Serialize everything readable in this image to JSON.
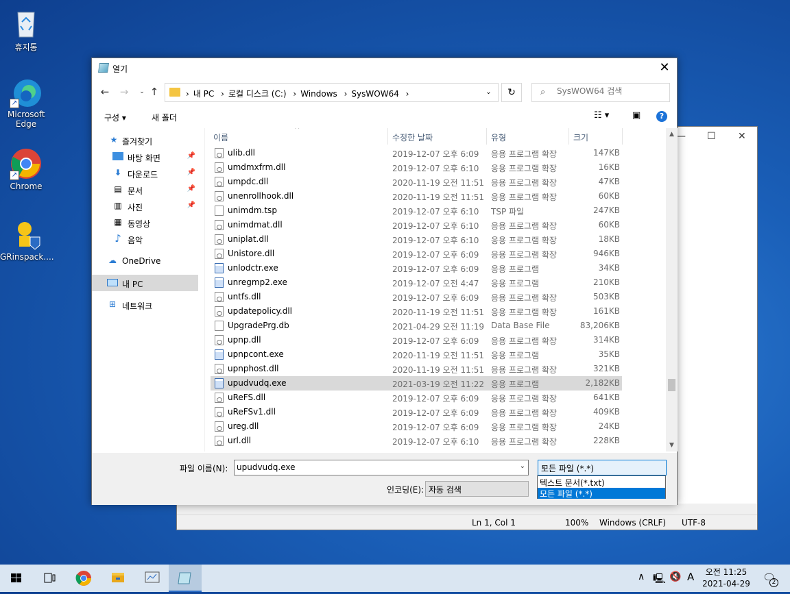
{
  "desktop": {
    "icons": [
      {
        "label": "휴지통"
      },
      {
        "label": "Microsoft Edge"
      },
      {
        "label": "Chrome"
      },
      {
        "label": "GRinspack...."
      }
    ]
  },
  "notepad": {
    "status": {
      "position": "Ln 1, Col 1",
      "zoom": "100%",
      "line_endings": "Windows (CRLF)",
      "encoding": "UTF-8"
    }
  },
  "dialog": {
    "title": "열기",
    "breadcrumbs": [
      "내 PC",
      "로컬 디스크 (C:)",
      "Windows",
      "SysWOW64"
    ],
    "search_placeholder": "SysWOW64 검색",
    "toolbar": {
      "organize": "구성 ▾",
      "new_folder": "새 폴더"
    },
    "nav": [
      {
        "label": "즐겨찾기",
        "icon": "star-icon"
      },
      {
        "label": "바탕 화면",
        "icon": "desktop-icon",
        "pinned": true
      },
      {
        "label": "다운로드",
        "icon": "download-icon",
        "pinned": true
      },
      {
        "label": "문서",
        "icon": "document-icon",
        "pinned": true
      },
      {
        "label": "사진",
        "icon": "pictures-icon",
        "pinned": true
      },
      {
        "label": "동영상",
        "icon": "video-icon"
      },
      {
        "label": "음악",
        "icon": "music-icon"
      },
      {
        "label": "OneDrive",
        "icon": "cloud-icon"
      },
      {
        "label": "내 PC",
        "icon": "pc-icon",
        "selected": true
      },
      {
        "label": "네트워크",
        "icon": "network-icon"
      }
    ],
    "columns": {
      "name": "이름",
      "date": "수정한 날짜",
      "type": "유형",
      "size": "크기"
    },
    "files": [
      {
        "name": "ulib.dll",
        "date": "2019-12-07 오후 6:09",
        "type": "응용 프로그램 확장",
        "size": "147KB",
        "kind": "dll"
      },
      {
        "name": "umdmxfrm.dll",
        "date": "2019-12-07 오후 6:10",
        "type": "응용 프로그램 확장",
        "size": "16KB",
        "kind": "dll"
      },
      {
        "name": "umpdc.dll",
        "date": "2020-11-19 오전 11:51",
        "type": "응용 프로그램 확장",
        "size": "47KB",
        "kind": "dll"
      },
      {
        "name": "unenrollhook.dll",
        "date": "2020-11-19 오전 11:51",
        "type": "응용 프로그램 확장",
        "size": "60KB",
        "kind": "dll"
      },
      {
        "name": "unimdm.tsp",
        "date": "2019-12-07 오후 6:10",
        "type": "TSP 파일",
        "size": "247KB",
        "kind": "file"
      },
      {
        "name": "unimdmat.dll",
        "date": "2019-12-07 오후 6:10",
        "type": "응용 프로그램 확장",
        "size": "60KB",
        "kind": "dll"
      },
      {
        "name": "uniplat.dll",
        "date": "2019-12-07 오후 6:10",
        "type": "응용 프로그램 확장",
        "size": "18KB",
        "kind": "dll"
      },
      {
        "name": "Unistore.dll",
        "date": "2019-12-07 오후 6:09",
        "type": "응용 프로그램 확장",
        "size": "946KB",
        "kind": "dll"
      },
      {
        "name": "unlodctr.exe",
        "date": "2019-12-07 오후 6:09",
        "type": "응용 프로그램",
        "size": "34KB",
        "kind": "exe"
      },
      {
        "name": "unregmp2.exe",
        "date": "2019-12-07 오전 4:47",
        "type": "응용 프로그램",
        "size": "210KB",
        "kind": "exe"
      },
      {
        "name": "untfs.dll",
        "date": "2019-12-07 오후 6:09",
        "type": "응용 프로그램 확장",
        "size": "503KB",
        "kind": "dll"
      },
      {
        "name": "updatepolicy.dll",
        "date": "2020-11-19 오전 11:51",
        "type": "응용 프로그램 확장",
        "size": "161KB",
        "kind": "dll"
      },
      {
        "name": "UpgradePrg.db",
        "date": "2021-04-29 오전 11:19",
        "type": "Data Base File",
        "size": "83,206KB",
        "kind": "file"
      },
      {
        "name": "upnp.dll",
        "date": "2019-12-07 오후 6:09",
        "type": "응용 프로그램 확장",
        "size": "314KB",
        "kind": "dll"
      },
      {
        "name": "upnpcont.exe",
        "date": "2020-11-19 오전 11:51",
        "type": "응용 프로그램",
        "size": "35KB",
        "kind": "exe"
      },
      {
        "name": "upnphost.dll",
        "date": "2020-11-19 오전 11:51",
        "type": "응용 프로그램 확장",
        "size": "321KB",
        "kind": "dll"
      },
      {
        "name": "upudvudq.exe",
        "date": "2021-03-19 오전 11:22",
        "type": "응용 프로그램",
        "size": "2,182KB",
        "kind": "exe",
        "selected": true
      },
      {
        "name": "uReFS.dll",
        "date": "2019-12-07 오후 6:09",
        "type": "응용 프로그램 확장",
        "size": "641KB",
        "kind": "dll"
      },
      {
        "name": "uReFSv1.dll",
        "date": "2019-12-07 오후 6:09",
        "type": "응용 프로그램 확장",
        "size": "409KB",
        "kind": "dll"
      },
      {
        "name": "ureg.dll",
        "date": "2019-12-07 오후 6:09",
        "type": "응용 프로그램 확장",
        "size": "24KB",
        "kind": "dll"
      },
      {
        "name": "url.dll",
        "date": "2019-12-07 오후 6:10",
        "type": "응용 프로그램 확장",
        "size": "228KB",
        "kind": "dll"
      }
    ],
    "filename_label": "파일 이름(N):",
    "filename_value": "upudvudq.exe",
    "filetype_selected": "모든 파일 (*.*)",
    "filetype_options": [
      "텍스트 문서(*.txt)",
      "모든 파일 (*.*)"
    ],
    "encoding_label": "인코딩(E):",
    "encoding_value": "자동 검색"
  },
  "taskbar": {
    "clock_time": "오전 11:25",
    "clock_date": "2021-04-29",
    "ime": "A",
    "notification_count": "2"
  },
  "colors": {
    "accent": "#0078d7",
    "taskbar": "#dae6f2",
    "selection": "#d9d9d9"
  }
}
